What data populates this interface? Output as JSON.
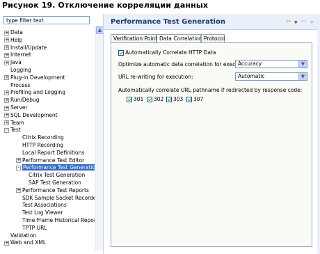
{
  "caption": "Рисунок 19. Отключение корреляции данных",
  "left": {
    "filter_placeholder": "type filter text",
    "tree": [
      {
        "label": "Data",
        "level": 0,
        "exp": "+"
      },
      {
        "label": "Help",
        "level": 0,
        "exp": "+"
      },
      {
        "label": "Install/Update",
        "level": 0,
        "exp": "+"
      },
      {
        "label": "Internet",
        "level": 0,
        "exp": "+"
      },
      {
        "label": "Java",
        "level": 0,
        "exp": "+"
      },
      {
        "label": "Logging",
        "level": 0,
        "exp": ""
      },
      {
        "label": "Plug-in Development",
        "level": 0,
        "exp": "+"
      },
      {
        "label": "Process",
        "level": 0,
        "exp": ""
      },
      {
        "label": "Profiling and Logging",
        "level": 0,
        "exp": "+"
      },
      {
        "label": "Run/Debug",
        "level": 0,
        "exp": "+"
      },
      {
        "label": "Server",
        "level": 0,
        "exp": "+"
      },
      {
        "label": "SQL Development",
        "level": 0,
        "exp": "+"
      },
      {
        "label": "Team",
        "level": 0,
        "exp": "+"
      },
      {
        "label": "Test",
        "level": 0,
        "exp": "−"
      },
      {
        "label": "Citrix Recording",
        "level": 1,
        "exp": ""
      },
      {
        "label": "HTTP Recording",
        "level": 1,
        "exp": ""
      },
      {
        "label": "Local Report Definitions",
        "level": 1,
        "exp": ""
      },
      {
        "label": "Performance Test Editor",
        "level": 1,
        "exp": "+"
      },
      {
        "label": "Performance Test Generation",
        "level": 1,
        "exp": "−",
        "selected": true
      },
      {
        "label": "Citrix Test Generation",
        "level": 2,
        "exp": ""
      },
      {
        "label": "SAP Test Generation",
        "level": 2,
        "exp": ""
      },
      {
        "label": "Performance Test Reports",
        "level": 1,
        "exp": "+"
      },
      {
        "label": "SDK Sample Socket Recorder",
        "level": 1,
        "exp": ""
      },
      {
        "label": "Test Associations",
        "level": 1,
        "exp": ""
      },
      {
        "label": "Test Log Viewer",
        "level": 1,
        "exp": ""
      },
      {
        "label": "Time Frame Historical Report",
        "level": 1,
        "exp": ""
      },
      {
        "label": "TPTP URL",
        "level": 1,
        "exp": ""
      },
      {
        "label": "Validation",
        "level": 0,
        "exp": ""
      },
      {
        "label": "Web and XML",
        "level": 0,
        "exp": "+"
      }
    ]
  },
  "right": {
    "title": "Performance Test Generation",
    "tabs": [
      "Verification Points",
      "Data Correlation",
      "Protocol"
    ],
    "active_tab": 1,
    "auto_correlate_label": "Automatically Correlate HTTP Data",
    "auto_correlate_checked": true,
    "optimize_label": "Optimize automatic data correlation for execution:",
    "optimize_value": "Accuracy",
    "rewrite_label": "URL re-writing for execution:",
    "rewrite_value": "Automatic",
    "redirect_label": "Automatically correlate URL pathname if redirected by response code:",
    "codes": [
      {
        "code": "301",
        "checked": true
      },
      {
        "code": "302",
        "checked": true
      },
      {
        "code": "303",
        "checked": true
      },
      {
        "code": "307",
        "checked": true
      }
    ]
  }
}
